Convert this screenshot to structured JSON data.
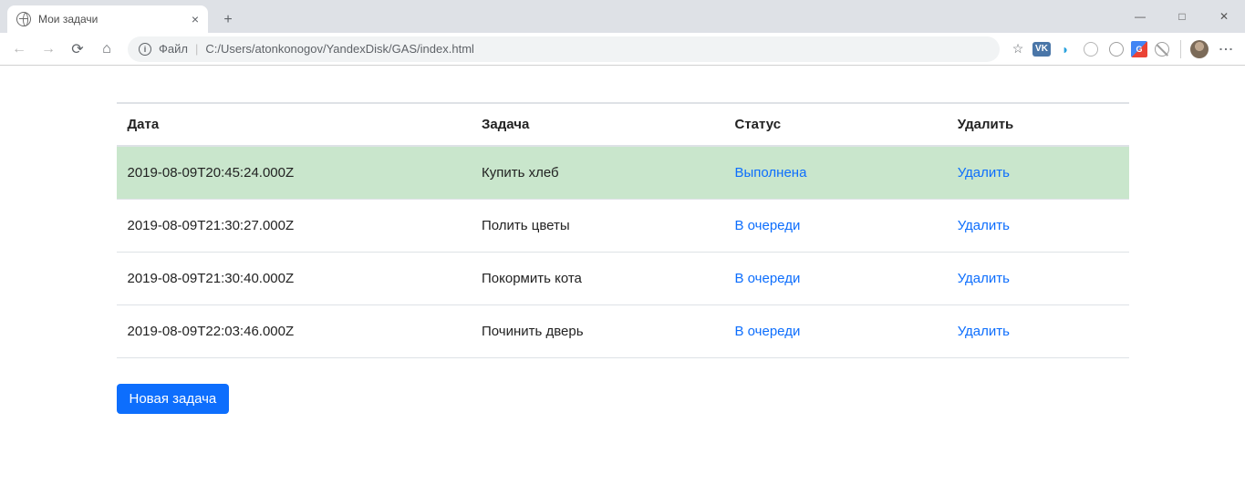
{
  "browser": {
    "tab_title": "Мои задачи",
    "addr_prefix": "Файл",
    "url": "C:/Users/atonkonogov/YandexDisk/GAS/index.html",
    "ext_vk_label": "VK",
    "ext_gt_label": "G"
  },
  "table": {
    "headers": {
      "date": "Дата",
      "task": "Задача",
      "status": "Статус",
      "delete": "Удалить"
    },
    "rows": [
      {
        "date": "2019-08-09T20:45:24.000Z",
        "task": "Купить хлеб",
        "status": "Выполнена",
        "delete": "Удалить",
        "done": true
      },
      {
        "date": "2019-08-09T21:30:27.000Z",
        "task": "Полить цветы",
        "status": "В очереди",
        "delete": "Удалить",
        "done": false
      },
      {
        "date": "2019-08-09T21:30:40.000Z",
        "task": "Покормить кота",
        "status": "В очереди",
        "delete": "Удалить",
        "done": false
      },
      {
        "date": "2019-08-09T22:03:46.000Z",
        "task": "Починить дверь",
        "status": "В очереди",
        "delete": "Удалить",
        "done": false
      }
    ]
  },
  "buttons": {
    "new_task": "Новая задача"
  }
}
